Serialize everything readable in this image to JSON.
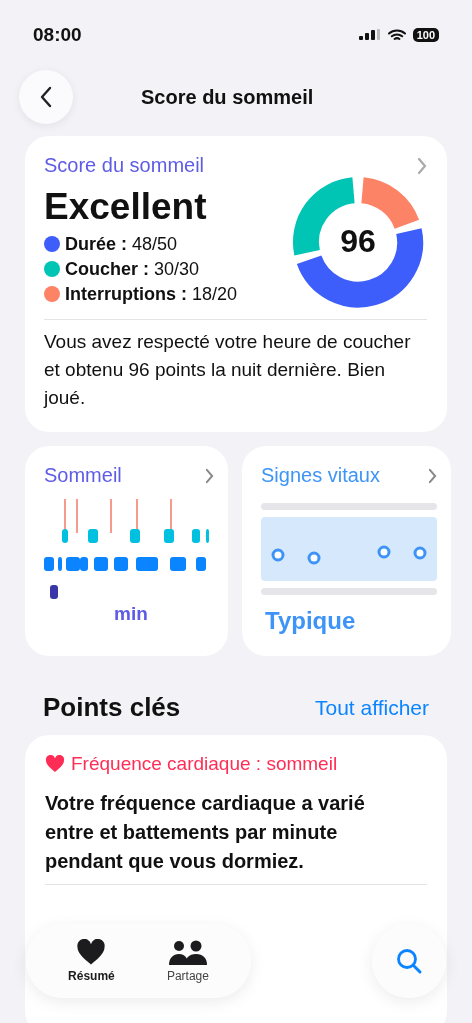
{
  "status_bar": {
    "time": "08:00",
    "battery": "100"
  },
  "nav": {
    "title": "Score du sommeil"
  },
  "score_card": {
    "title": "Score du sommeil",
    "rating": "Excellent",
    "score": "96",
    "legend": [
      {
        "label": "Durée :",
        "value": "48/50",
        "color": "#3e5efc"
      },
      {
        "label": "Coucher :",
        "value": "30/30",
        "color": "#00c4b4"
      },
      {
        "label": "Interruptions :",
        "value": "18/20",
        "color": "#fd8366"
      }
    ],
    "summary": "Vous avez respecté votre heure de coucher et obtenu 96 points la nuit dernière. Bien joué."
  },
  "sleep_card": {
    "title": "Sommeil",
    "caption": "min"
  },
  "vitals_card": {
    "title": "Signes vitaux",
    "status": "Typique"
  },
  "highlights": {
    "title": "Points clés",
    "link": "Tout afficher",
    "card": {
      "title": "Fréquence cardiaque : sommeil",
      "text": "Votre fréquence cardiaque a varié entre et battements par minute pendant que vous dormiez."
    }
  },
  "tab_bar": [
    {
      "label": "Résumé",
      "kind": "heart",
      "selected": true
    },
    {
      "label": "Partage",
      "kind": "people",
      "selected": false
    }
  ]
}
